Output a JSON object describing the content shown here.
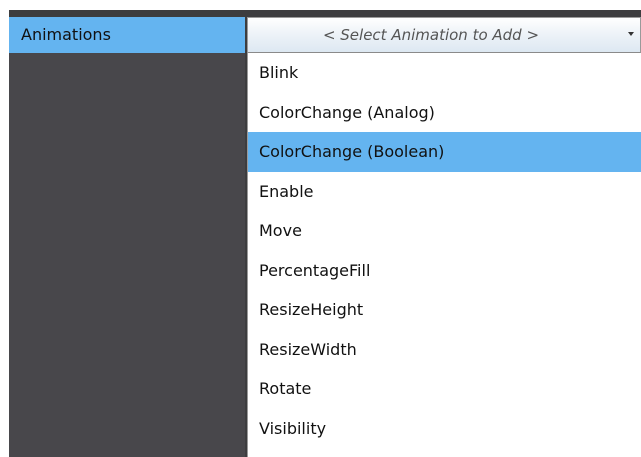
{
  "property_label": "Animations",
  "select": {
    "placeholder": "< Select Animation to Add >"
  },
  "options": [
    {
      "label": "Blink"
    },
    {
      "label": "ColorChange (Analog)"
    },
    {
      "label": "ColorChange (Boolean)"
    },
    {
      "label": "Enable"
    },
    {
      "label": "Move"
    },
    {
      "label": "PercentageFill"
    },
    {
      "label": "ResizeHeight"
    },
    {
      "label": "ResizeWidth"
    },
    {
      "label": "Rotate"
    },
    {
      "label": "Visibility"
    }
  ],
  "highlighted_option": "ColorChange (Boolean)",
  "colors": {
    "highlight": "#64b4f0",
    "panel_dark": "#48474b",
    "border_dark": "#3d3d3f"
  }
}
